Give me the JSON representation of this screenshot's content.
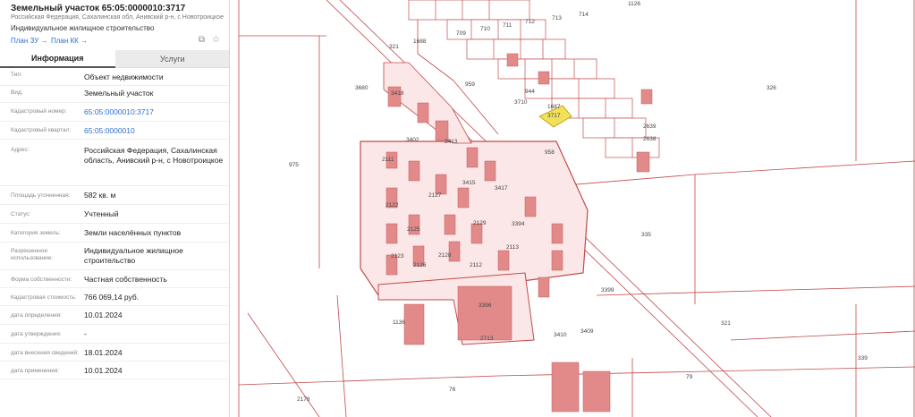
{
  "panel": {
    "title": "Земельный участок 65:05:0000010:3717",
    "address_short": "Российская Федерация, Сахалинская обл, Анивский р-н, с Новотроицкое",
    "purpose": "Индивидуальное жилищное строительство",
    "links": {
      "plan_zu": "План ЗУ →",
      "plan_kk": "План КК →"
    },
    "icons": {
      "measure": "measure-icon",
      "favorite": "star-icon"
    },
    "tabs": {
      "info": "Информация",
      "services": "Услуги"
    },
    "rows": [
      {
        "label": "Тип:",
        "value": "Объект недвижимости"
      },
      {
        "label": "Вид:",
        "value": "Земельный участок"
      },
      {
        "label": "Кадастровый номер:",
        "value": "65:05:0000010:3717"
      },
      {
        "label": "Кадастровый квартал:",
        "value": "65:05:0000010"
      },
      {
        "label": "Адрес:",
        "value": "Российская Федерация, Сахалинская область, Анивский р-н, с Новотроицкое"
      },
      {
        "label": "Площадь уточненная:",
        "value": "582 кв. м"
      },
      {
        "label": "Статус:",
        "value": "Учтенный"
      },
      {
        "label": "Категория земель:",
        "value": "Земли населённых пунктов"
      },
      {
        "label": "Разрешенное использование:",
        "value": "Индивидуальное жилищное строительство"
      },
      {
        "label": "Форма собственности:",
        "value": "Частная собственность"
      },
      {
        "label": "Кадастровая стоимость:",
        "value": "766 069,14 руб."
      },
      {
        "label": "дата определения:",
        "value": "10.01.2024"
      },
      {
        "label": "дата утверждения:",
        "value": "-"
      },
      {
        "label": "дата внесения сведений:",
        "value": "18.01.2024"
      },
      {
        "label": "дата применения:",
        "value": "10.01.2024"
      }
    ]
  },
  "map": {
    "colors": {
      "line": "#c24a4a",
      "building": "#e28a8a",
      "highlight": "#f2e05a"
    },
    "labels": {
      "l1126": "1126",
      "l709": "709",
      "l710": "710",
      "l711": "711",
      "l712": "712",
      "l713": "713",
      "l714": "714",
      "l1688": "1688",
      "l321a": "321",
      "l3680": "3680",
      "l959": "959",
      "l944": "944",
      "l1687": "1687",
      "l3717": "3717",
      "l3710": "3710",
      "l958": "958",
      "l2639": "2639",
      "l2638": "2638",
      "l326": "326",
      "l3418": "3418",
      "l3402": "3402",
      "l3413": "3413",
      "l975": "975",
      "l2111": "2111",
      "l2122": "2122",
      "l2127": "2127",
      "l2129": "2129",
      "l3415": "3415",
      "l3417": "3417",
      "l3394": "3394",
      "l2125": "2125",
      "l2128": "2128",
      "l2113": "2113",
      "l2123": "2123",
      "l2126": "2126",
      "l2112": "2112",
      "l335": "335",
      "l3399": "3399",
      "l3396": "3396",
      "l1136": "1136",
      "l3409": "3409",
      "l3410": "3410",
      "l2713": "2713",
      "l321b": "321",
      "l79": "79",
      "l339": "339",
      "l76": "76",
      "l2178": "2178"
    }
  }
}
